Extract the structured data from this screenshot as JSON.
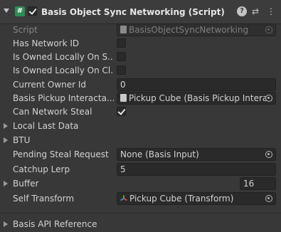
{
  "header": {
    "title": "Basis Object Sync Networking (Script)",
    "script_icon_glyph": "#",
    "help_glyph": "?",
    "preset_glyph": "⇄",
    "menu_glyph": "⋮"
  },
  "fields": {
    "script": {
      "label": "Script",
      "value": "BasisObjectSyncNetworking"
    },
    "has_network_id": {
      "label": "Has Network ID",
      "checked": false
    },
    "is_owned_locally_on_s": {
      "label": "Is Owned Locally On S...",
      "checked": false
    },
    "is_owned_locally_on_cl": {
      "label": "Is Owned Locally On Cl...",
      "checked": false
    },
    "current_owner_id": {
      "label": "Current Owner Id",
      "value": "0"
    },
    "basis_pickup": {
      "label": "Basis Pickup Interacta...",
      "value": "Pickup Cube (Basis Pickup Interac"
    },
    "can_network_steal": {
      "label": "Can Network Steal",
      "checked": true
    },
    "local_last_data": {
      "label": "Local Last Data"
    },
    "btu": {
      "label": "BTU"
    },
    "pending_steal_request": {
      "label": "Pending Steal Request",
      "value": "None (Basis Input)"
    },
    "catchup_lerp": {
      "label": "Catchup Lerp",
      "value": "5"
    },
    "buffer": {
      "label": "Buffer",
      "value": "16"
    },
    "self_transform": {
      "label": "Self Transform",
      "value": "Pickup Cube (Transform)"
    },
    "basis_api_reference": {
      "label": "Basis API Reference"
    }
  },
  "colors": {
    "background": "#383838",
    "field_bg": "#2a2a2a",
    "script_icon": "#2e8d58"
  },
  "icons": [
    "foldout-arrow-icon",
    "script-icon",
    "help-icon",
    "preset-icon",
    "menu-icon",
    "object-picker-icon",
    "transform-icon",
    "cube-icon"
  ]
}
